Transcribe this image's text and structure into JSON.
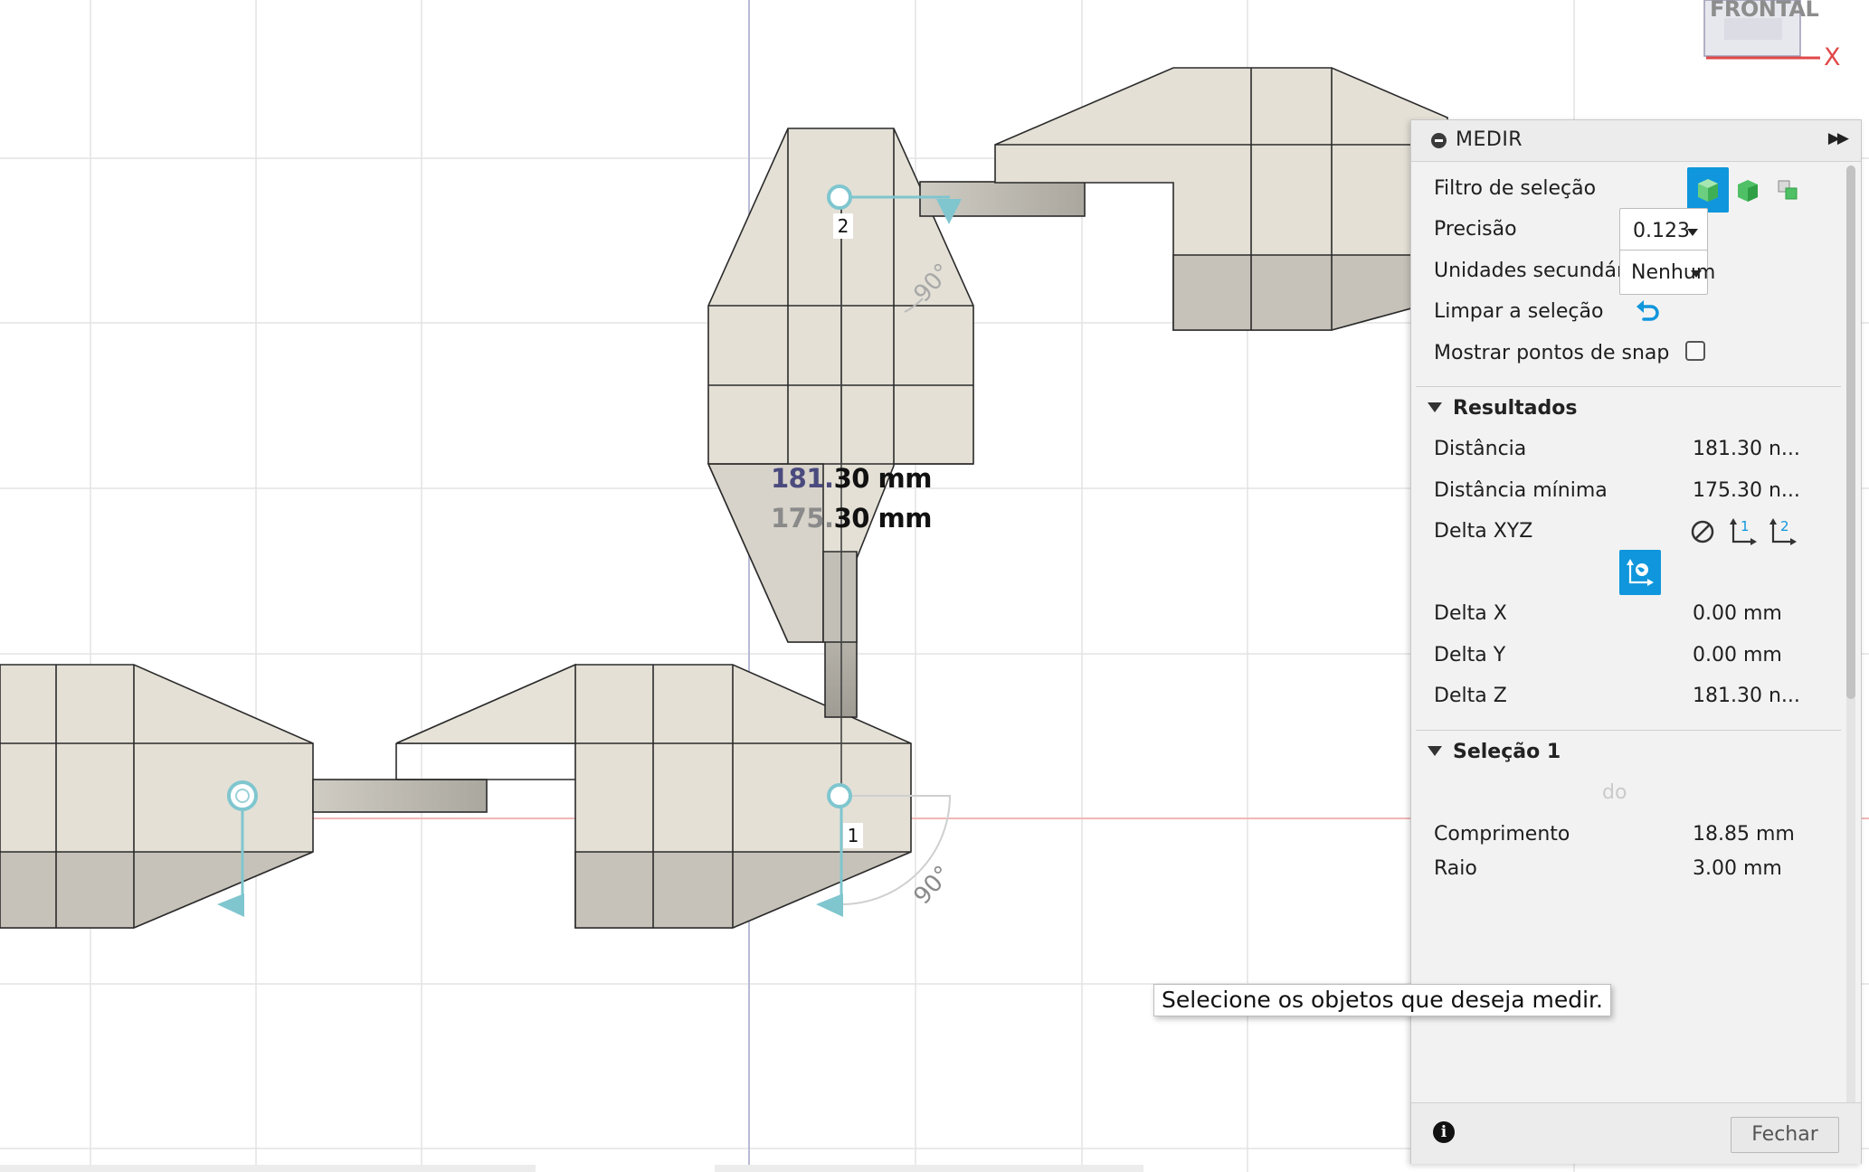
{
  "viewcube": {
    "label": "FRONTAL",
    "axis": "X"
  },
  "viewport": {
    "measure_primary": {
      "dim": "181.",
      "main": "30 mm"
    },
    "measure_secondary": {
      "dim": "175.",
      "main": "30 mm"
    },
    "point_1": "1",
    "point_2": "2",
    "angle_upper": "90°",
    "angle_lower": "90°"
  },
  "tooltip": "Selecione os objetos que deseja medir.",
  "panel": {
    "title": "MEDIR",
    "selection_filter_label": "Filtro de seleção",
    "precision_label": "Precisão",
    "precision_value": "0.123",
    "secondary_units_label": "Unidades secundárias",
    "secondary_units_value": "Nenhum",
    "clear_selection_label": "Limpar a seleção",
    "show_snap_label": "Mostrar pontos de snap",
    "show_snap_checked": false,
    "results": {
      "title": "Resultados",
      "distance_label": "Distância",
      "distance_value": "181.30 n...",
      "min_distance_label": "Distância mínima",
      "min_distance_value": "175.30 n...",
      "delta_xyz_label": "Delta XYZ",
      "delta_x_label": "Delta X",
      "delta_x_value": "0.00 mm",
      "delta_y_label": "Delta Y",
      "delta_y_value": "0.00 mm",
      "delta_z_label": "Delta Z",
      "delta_z_value": "181.30 n..."
    },
    "selection1": {
      "title": "Seleção 1",
      "partial_label": "do",
      "length_label": "Comprimento",
      "length_value": "18.85 mm",
      "radius_label": "Raio",
      "radius_value": "3.00 mm"
    },
    "close_button": "Fechar"
  },
  "colors": {
    "accent": "#0f96dc",
    "body_light": "#e4e0d6",
    "body_mid": "#d2cec5",
    "body_dark": "#c2beb5",
    "snap": "#7fc6cf"
  }
}
